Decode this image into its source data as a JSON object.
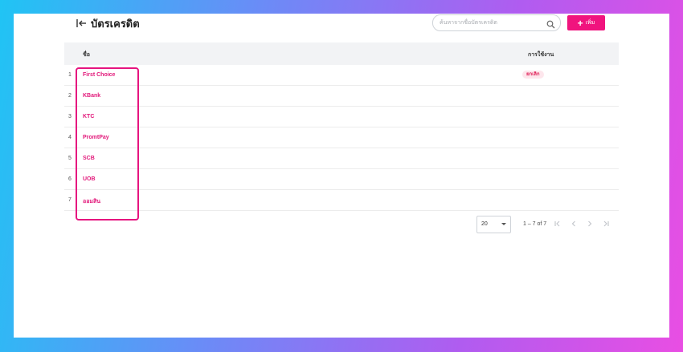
{
  "header": {
    "title": "บัตรเครดิต",
    "search_placeholder": "ค้นหาจากชื่อบัตรเครดิต",
    "add_label": "เพิ่ม"
  },
  "table": {
    "columns": {
      "name": "ชื่อ",
      "usage": "การใช้งาน"
    },
    "rows": [
      {
        "num": "1",
        "name": "First Choice",
        "status": "ยกเลิก"
      },
      {
        "num": "2",
        "name": "KBank",
        "status": ""
      },
      {
        "num": "3",
        "name": "KTC",
        "status": ""
      },
      {
        "num": "4",
        "name": "PromtPay",
        "status": ""
      },
      {
        "num": "5",
        "name": "SCB",
        "status": ""
      },
      {
        "num": "6",
        "name": "UOB",
        "status": ""
      },
      {
        "num": "7",
        "name": "ออมสิน",
        "status": ""
      }
    ]
  },
  "pagination": {
    "page_size": "20",
    "range": "1 – 7 of 7"
  },
  "colors": {
    "accent": "#f0147e",
    "link": "#e2187a",
    "badge_bg": "#fde6ec",
    "badge_text": "#e0245a"
  }
}
